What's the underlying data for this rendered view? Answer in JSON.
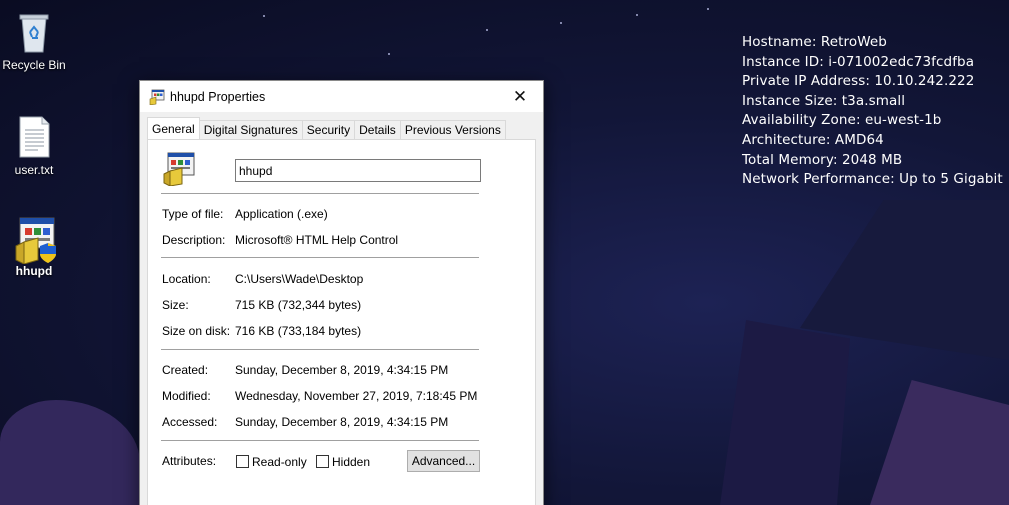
{
  "desktop": {
    "icons": [
      {
        "label": "Recycle Bin"
      },
      {
        "label": "user.txt"
      },
      {
        "label": "hhupd"
      }
    ],
    "info_lines": [
      "Hostname: RetroWeb",
      "Instance ID: i-071002edc73fcdfba",
      "Private IP Address: 10.10.242.222",
      "Instance Size: t3a.small",
      "Availability Zone: eu-west-1b",
      "Architecture: AMD64",
      "Total Memory: 2048 MB",
      "Network Performance: Up to 5 Gigabit"
    ]
  },
  "window": {
    "title": "hhupd Properties",
    "close_glyph": "✕",
    "tabs": [
      "General",
      "Digital Signatures",
      "Security",
      "Details",
      "Previous Versions"
    ],
    "active_tab": "General",
    "file_name": "hhupd",
    "fields": {
      "type_label": "Type of file:",
      "type_value": "Application (.exe)",
      "desc_label": "Description:",
      "desc_value": "Microsoft® HTML Help Control",
      "location_label": "Location:",
      "location_value": "C:\\Users\\Wade\\Desktop",
      "size_label": "Size:",
      "size_value": "715 KB (732,344 bytes)",
      "size_disk_label": "Size on disk:",
      "size_disk_value": "716 KB (733,184 bytes)",
      "created_label": "Created:",
      "created_value": "Sunday, December 8, 2019, 4:34:15 PM",
      "modified_label": "Modified:",
      "modified_value": "Wednesday, November 27, 2019, 7:18:45 PM",
      "accessed_label": "Accessed:",
      "accessed_value": "Sunday, December 8, 2019, 4:34:15 PM",
      "attributes_label": "Attributes:"
    },
    "attributes": {
      "readonly_label": "Read-only",
      "readonly_checked": false,
      "hidden_label": "Hidden",
      "hidden_checked": false,
      "advanced_label": "Advanced..."
    }
  },
  "colors": {
    "desktop_bg": "#121638",
    "window_bg": "#f0f0f0",
    "panel_bg": "#ffffff"
  }
}
